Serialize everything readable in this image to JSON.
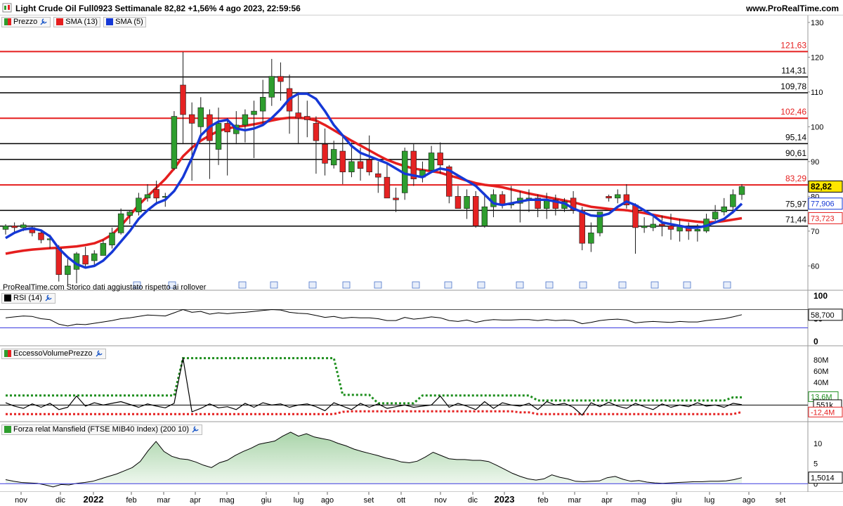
{
  "header": {
    "title": "Light Crude Oil Full0923 Settimanale 82,82 +1,56% 4 ago 2023, 22:59:56",
    "site": "www.ProRealTime.com"
  },
  "legend": {
    "price": "Prezzo",
    "sma13": "SMA (13)",
    "sma5": "SMA (5)",
    "rsi": "RSI (14)",
    "volume": "EccessoVolumePrezzo",
    "mansfield": "Forza relat Mansfield (FTSE MIB40 Index) (200 10)"
  },
  "footnote": "ProRealTime.com  Storico dati aggiustato rispetto ai rollover",
  "colors": {
    "up": "#2e9e2e",
    "down": "#e52222",
    "sma13": "#e51e1e",
    "sma5": "#1538d6",
    "line_red": "#e51e1e",
    "line_black": "#000000",
    "rsi_line": "#000000",
    "rsi_bands": "#3a3adf",
    "mansfield_fill": "#cfe5cf",
    "vol_upper": "#1f8f1f",
    "vol_lower": "#e52222"
  },
  "chart_data": [
    {
      "type": "candlestick",
      "name": "price",
      "ylim": [
        53,
        132
      ],
      "yticks": [
        60,
        70,
        80,
        90,
        100,
        110,
        120,
        130
      ],
      "xticks": [
        "nov",
        "dic",
        "2022",
        "feb",
        "mar",
        "apr",
        "mag",
        "giu",
        "lug",
        "ago",
        "set",
        "ott",
        "nov",
        "dic",
        "2023",
        "feb",
        "mar",
        "apr",
        "mag",
        "giu",
        "lug",
        "ago",
        "set"
      ],
      "horizontal_levels": [
        {
          "value": 121.63,
          "label": "121,63",
          "color": "red"
        },
        {
          "value": 114.31,
          "label": "114,31",
          "color": "black"
        },
        {
          "value": 109.78,
          "label": "109,78",
          "color": "black"
        },
        {
          "value": 102.46,
          "label": "102,46",
          "color": "red"
        },
        {
          "value": 95.14,
          "label": "95,14",
          "color": "black"
        },
        {
          "value": 90.61,
          "label": "90,61",
          "color": "black"
        },
        {
          "value": 83.29,
          "label": "83,29",
          "color": "red"
        },
        {
          "value": 75.97,
          "label": "75,97",
          "color": "black"
        },
        {
          "value": 71.44,
          "label": "71,44",
          "color": "black"
        }
      ],
      "last_values": {
        "price": "82,82",
        "sma5": "77,906",
        "sma13": "73,723"
      },
      "candles": [
        [
          70.5,
          72.0,
          69.0,
          71.5
        ],
        [
          71.5,
          72.5,
          69.5,
          71.0
        ],
        [
          71.0,
          72.5,
          70.0,
          71.8
        ],
        [
          71.0,
          71.5,
          68.5,
          69.5
        ],
        [
          69.5,
          70.0,
          66.5,
          67.5
        ],
        [
          67.5,
          69.0,
          65.0,
          67.8
        ],
        [
          65.0,
          66.0,
          55.5,
          57.5
        ],
        [
          57.5,
          62.0,
          54.5,
          60.0
        ],
        [
          59.0,
          64.0,
          55.0,
          63.5
        ],
        [
          63.0,
          65.5,
          59.5,
          60.5
        ],
        [
          61.5,
          64.5,
          60.0,
          63.5
        ],
        [
          63.0,
          67.5,
          63.0,
          66.5
        ],
        [
          66.0,
          71.0,
          65.0,
          69.5
        ],
        [
          69.5,
          76.5,
          69.0,
          75.0
        ],
        [
          74.5,
          76.0,
          72.0,
          75.5
        ],
        [
          75.5,
          81.0,
          74.5,
          79.5
        ],
        [
          79.5,
          83.5,
          78.5,
          80.5
        ],
        [
          82.0,
          84.5,
          77.5,
          79.5
        ],
        [
          80.0,
          81.0,
          77.0,
          80.0
        ],
        [
          88.0,
          104.5,
          87.5,
          103.0
        ],
        [
          112.0,
          121.5,
          95.0,
          103.5
        ],
        [
          103.5,
          107.0,
          84.5,
          101.0
        ],
        [
          100.0,
          108.5,
          96.5,
          105.5
        ],
        [
          103.5,
          105.0,
          85.0,
          96.0
        ],
        [
          93.5,
          105.5,
          89.0,
          101.0
        ],
        [
          101.0,
          102.5,
          86.0,
          98.5
        ],
        [
          98.0,
          104.5,
          95.0,
          100.5
        ],
        [
          100.5,
          105.0,
          95.5,
          103.5
        ],
        [
          103.5,
          107.5,
          91.0,
          104.5
        ],
        [
          104.5,
          113.5,
          101.0,
          108.5
        ],
        [
          108.5,
          119.5,
          106.0,
          114.5
        ],
        [
          114.5,
          118.5,
          107.5,
          113.0
        ],
        [
          111.0,
          115.0,
          98.0,
          104.5
        ],
        [
          104.0,
          110.0,
          95.0,
          102.5
        ],
        [
          103.0,
          107.5,
          97.0,
          102.0
        ],
        [
          101.0,
          103.0,
          86.5,
          96.0
        ],
        [
          95.0,
          99.5,
          86.0,
          89.5
        ],
        [
          89.0,
          96.0,
          88.0,
          93.5
        ],
        [
          93.0,
          97.5,
          83.5,
          87.0
        ],
        [
          87.0,
          95.5,
          85.5,
          90.0
        ],
        [
          90.0,
          94.0,
          84.5,
          88.0
        ],
        [
          90.5,
          97.5,
          86.0,
          87.0
        ],
        [
          86.5,
          90.0,
          81.0,
          85.5
        ],
        [
          85.5,
          89.5,
          80.0,
          79.5
        ],
        [
          79.5,
          82.5,
          75.5,
          79.0
        ],
        [
          81.0,
          94.0,
          79.0,
          93.0
        ],
        [
          93.0,
          95.0,
          83.0,
          85.0
        ],
        [
          85.5,
          90.0,
          84.0,
          87.5
        ],
        [
          87.5,
          94.5,
          87.5,
          92.5
        ],
        [
          92.5,
          95.5,
          86.5,
          89.0
        ],
        [
          88.5,
          89.0,
          78.0,
          80.0
        ],
        [
          80.0,
          83.0,
          77.0,
          76.5
        ],
        [
          76.5,
          82.0,
          73.5,
          80.0
        ],
        [
          80.0,
          81.5,
          71.0,
          71.5
        ],
        [
          71.5,
          81.0,
          71.0,
          77.0
        ],
        [
          77.0,
          82.0,
          74.0,
          80.5
        ],
        [
          80.5,
          81.5,
          76.5,
          77.5
        ],
        [
          77.5,
          83.0,
          76.5,
          78.0
        ],
        [
          78.0,
          81.5,
          72.5,
          79.5
        ],
        [
          79.5,
          82.0,
          75.5,
          79.5
        ],
        [
          79.5,
          80.5,
          74.0,
          76.5
        ],
        [
          76.5,
          81.0,
          73.5,
          79.0
        ],
        [
          79.0,
          80.5,
          74.5,
          76.5
        ],
        [
          76.5,
          79.5,
          75.5,
          78.5
        ],
        [
          79.5,
          81.5,
          75.0,
          76.0
        ],
        [
          76.0,
          77.0,
          64.5,
          66.5
        ],
        [
          66.5,
          72.5,
          64.0,
          69.5
        ],
        [
          69.5,
          75.5,
          68.5,
          75.5
        ],
        [
          80.0,
          80.5,
          78.5,
          79.5
        ],
        [
          79.5,
          82.0,
          78.0,
          80.5
        ],
        [
          80.5,
          83.5,
          76.5,
          77.5
        ],
        [
          77.5,
          78.0,
          63.5,
          71.0
        ],
        [
          71.0,
          74.0,
          69.5,
          71.5
        ],
        [
          71.0,
          74.0,
          70.0,
          72.0
        ],
        [
          72.0,
          74.5,
          68.5,
          71.5
        ],
        [
          71.5,
          75.0,
          67.5,
          70.5
        ],
        [
          70.0,
          73.5,
          67.0,
          71.5
        ],
        [
          71.0,
          72.5,
          67.5,
          70.0
        ],
        [
          70.0,
          72.0,
          67.0,
          70.5
        ],
        [
          70.0,
          75.0,
          69.5,
          73.5
        ],
        [
          73.5,
          77.5,
          73.0,
          75.5
        ],
        [
          75.5,
          79.5,
          74.5,
          77.0
        ],
        [
          77.0,
          82.0,
          75.0,
          80.5
        ],
        [
          80.5,
          83.5,
          79.0,
          82.8
        ]
      ],
      "sma13": [
        63.5,
        64.0,
        64.4,
        64.7,
        64.9,
        65.1,
        65.2,
        65.4,
        65.6,
        66.0,
        66.5,
        67.5,
        69.0,
        71.5,
        74.5,
        77.5,
        80.0,
        82.5,
        85.0,
        88.0,
        91.5,
        94.0,
        96.0,
        97.5,
        98.8,
        99.5,
        100.0,
        100.3,
        100.7,
        101.2,
        101.8,
        102.3,
        102.6,
        102.6,
        102.4,
        101.8,
        100.5,
        99.0,
        97.5,
        96.0,
        94.6,
        93.2,
        91.8,
        90.5,
        89.5,
        88.7,
        88.0,
        87.6,
        87.2,
        86.8,
        86.0,
        85.3,
        84.5,
        83.8,
        83.3,
        83.0,
        82.6,
        82.0,
        81.4,
        80.8,
        80.3,
        79.8,
        79.3,
        78.8,
        78.3,
        77.6,
        77.0,
        76.7,
        76.4,
        76.2,
        76.0,
        75.6,
        75.2,
        74.7,
        74.2,
        73.7,
        73.3,
        73.0,
        72.7,
        72.5,
        72.6,
        72.9,
        73.3,
        73.7
      ],
      "sma5": [
        68.0,
        69.5,
        70.5,
        70.8,
        70.2,
        68.5,
        65.0,
        62.5,
        60.5,
        59.5,
        60.0,
        61.5,
        64.0,
        67.0,
        70.0,
        73.5,
        76.0,
        78.0,
        79.0,
        81.5,
        85.5,
        91.0,
        97.5,
        100.0,
        101.5,
        102.0,
        99.5,
        99.0,
        99.5,
        100.5,
        102.5,
        105.0,
        108.0,
        109.5,
        109.5,
        108.0,
        104.5,
        100.5,
        97.5,
        94.5,
        92.5,
        91.5,
        90.5,
        89.5,
        88.0,
        86.5,
        86.0,
        85.5,
        87.0,
        88.0,
        87.5,
        86.0,
        84.5,
        83.0,
        80.5,
        78.0,
        77.5,
        78.0,
        78.5,
        79.0,
        79.0,
        79.0,
        78.5,
        78.0,
        76.5,
        75.5,
        74.5,
        74.3,
        75.0,
        77.0,
        78.5,
        77.5,
        76.0,
        74.5,
        72.5,
        72.0,
        71.5,
        71.0,
        71.0,
        71.5,
        72.5,
        73.5,
        75.5,
        77.9
      ]
    },
    {
      "type": "line",
      "name": "rsi",
      "ylim": [
        0,
        100
      ],
      "yticks": [
        0,
        50,
        100
      ],
      "bands": [
        30,
        70
      ],
      "last_value": "58,700",
      "values": [
        52,
        54,
        56,
        55,
        50,
        48,
        38,
        34,
        38,
        37,
        40,
        43,
        46,
        50,
        52,
        55,
        58,
        57,
        56,
        63,
        70,
        64,
        66,
        60,
        63,
        61,
        63,
        64,
        66,
        68,
        70,
        69,
        64,
        62,
        61,
        57,
        53,
        55,
        51,
        53,
        52,
        52,
        50,
        46,
        46,
        53,
        49,
        51,
        54,
        52,
        46,
        44,
        47,
        42,
        46,
        48,
        47,
        47,
        48,
        48,
        46,
        48,
        46,
        47,
        46,
        39,
        42,
        46,
        48,
        49,
        47,
        41,
        43,
        44,
        43,
        42,
        44,
        43,
        43,
        46,
        48,
        50,
        54,
        58.7
      ]
    },
    {
      "type": "line",
      "name": "eccesso_volume_prezzo",
      "ylim": [
        -22,
        95
      ],
      "yticks": [
        0,
        20,
        40,
        60,
        80
      ],
      "ytick_labels": [
        "0",
        "20M",
        "40M",
        "60M",
        "80M"
      ],
      "last_values": {
        "upper": "13,6M",
        "value": "551k",
        "lower": "-12,4M"
      },
      "values": [
        4,
        -2,
        -6,
        2,
        -4,
        3,
        -8,
        -4,
        16,
        -2,
        4,
        0,
        3,
        6,
        1,
        -4,
        2,
        -2,
        -5,
        3,
        83,
        -12,
        -6,
        2,
        -5,
        -3,
        -8,
        3,
        -4,
        4,
        0,
        2,
        -4,
        0,
        2,
        -3,
        -10,
        4,
        -2,
        -8,
        3,
        -4,
        2,
        -6,
        -3,
        0,
        -4,
        -2,
        0,
        16,
        -4,
        3,
        -2,
        -8,
        6,
        -6,
        4,
        0,
        -2,
        3,
        -8,
        6,
        0,
        3,
        -4,
        -18,
        4,
        -3,
        5,
        -2,
        -6,
        3,
        -3,
        -8,
        2,
        -4,
        0,
        -3,
        4,
        -2,
        0,
        -4,
        3,
        0.5
      ],
      "upper": [
        17,
        17,
        17,
        17,
        17,
        17,
        17,
        17,
        17,
        17,
        17,
        17,
        17,
        17,
        17,
        17,
        17,
        17,
        17,
        17,
        83,
        83,
        83,
        83,
        83,
        83,
        83,
        83,
        83,
        83,
        83,
        83,
        83,
        83,
        83,
        83,
        83,
        83,
        18,
        18,
        18,
        18,
        3,
        3,
        3,
        3,
        3,
        17,
        17,
        17,
        17,
        17,
        17,
        17,
        17,
        17,
        17,
        17,
        17,
        17,
        8,
        8,
        8,
        8,
        8,
        8,
        8,
        8,
        8,
        8,
        8,
        8,
        8,
        8,
        8,
        8,
        8,
        8,
        8,
        8,
        8,
        8,
        13.6,
        13.6
      ],
      "lower": [
        -16,
        -16,
        -16,
        -16,
        -16,
        -16,
        -16,
        -16,
        -16,
        -16,
        -16,
        -16,
        -16,
        -16,
        -16,
        -16,
        -16,
        -16,
        -16,
        -16,
        -16,
        -16,
        -16,
        -16,
        -16,
        -16,
        -16,
        -16,
        -16,
        -16,
        -16,
        -16,
        -16,
        -16,
        -16,
        -16,
        -16,
        -16,
        -12,
        -11,
        -11,
        -11,
        -11,
        -11,
        -11,
        -11,
        -11,
        -11,
        -11,
        -11,
        -11,
        -11,
        -11,
        -11,
        -11,
        -11,
        -11,
        -11,
        -13,
        -13,
        -16,
        -16,
        -16,
        -16,
        -16,
        -16,
        -16,
        -16,
        -16,
        -16,
        -16,
        -16,
        -16,
        -16,
        -16,
        -16,
        -16,
        -16,
        -16,
        -16,
        -16,
        -16,
        -16,
        -12.4
      ]
    },
    {
      "type": "area",
      "name": "mansfield",
      "ylim": [
        -1,
        14
      ],
      "yticks": [
        0,
        5,
        10
      ],
      "last_value": "1,5014",
      "values": [
        1.0,
        0.6,
        0.3,
        0.2,
        0.1,
        -0.3,
        -0.8,
        -0.2,
        -0.3,
        0.1,
        0.3,
        0.6,
        1.2,
        1.8,
        2.4,
        3.2,
        4.0,
        5.5,
        8.2,
        10.5,
        8.0,
        6.8,
        6.2,
        6.0,
        5.4,
        4.6,
        4.0,
        5.2,
        5.8,
        7.0,
        8.0,
        8.8,
        9.8,
        10.2,
        10.6,
        11.8,
        12.8,
        11.8,
        12.4,
        11.6,
        11.2,
        10.8,
        10.0,
        9.4,
        8.6,
        8.0,
        7.5,
        7.0,
        6.4,
        6.0,
        5.4,
        5.2,
        5.6,
        6.6,
        7.8,
        7.0,
        6.2,
        6.0,
        6.0,
        5.8,
        5.8,
        5.5,
        4.6,
        3.6,
        2.6,
        1.8,
        1.2,
        0.9,
        1.2,
        2.2,
        1.6,
        1.2,
        0.6,
        0.5,
        0.6,
        0.7,
        1.5,
        1.8,
        1.1,
        0.6,
        0.8,
        0.4,
        0.2,
        0.1,
        0.2,
        0.3,
        0.4,
        0.5,
        0.5,
        0.6,
        0.6,
        0.7,
        1.0,
        1.5
      ]
    }
  ]
}
